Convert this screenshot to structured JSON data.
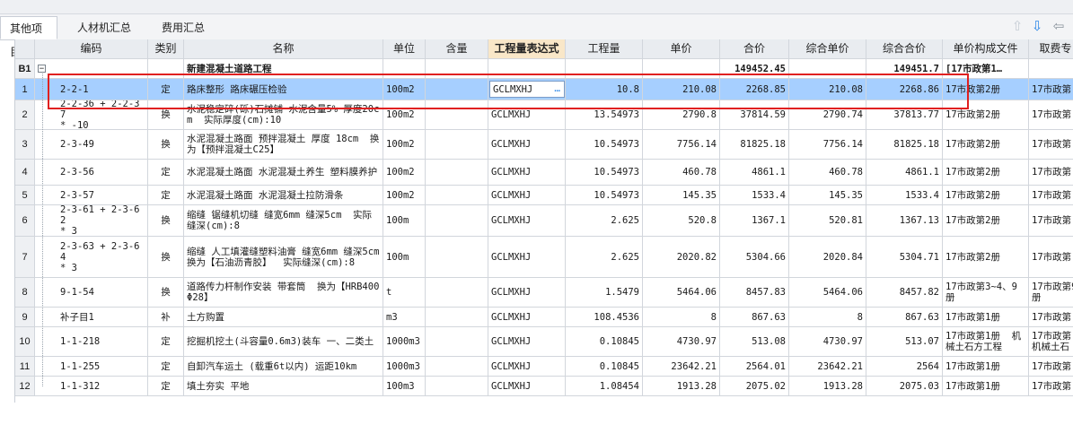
{
  "tabs": [
    "其他项目",
    "人材机汇总",
    "费用汇总"
  ],
  "columns": [
    "编码",
    "类别",
    "名称",
    "单位",
    "含量",
    "工程量表达式",
    "工程量",
    "单价",
    "合价",
    "综合单价",
    "综合合价",
    "单价构成文件",
    "取费专"
  ],
  "group_row": {
    "id": "B1",
    "toggle": "−",
    "name": "新建混凝土道路工程",
    "total": "149452.45",
    "comp_total": "149451.7",
    "file": "[17市政第1…"
  },
  "rows": [
    {
      "no": "1",
      "code": "2-2-1",
      "type": "定",
      "name": "路床整形 路床碾压检验",
      "unit": "100m2",
      "expr": "GCLMXHJ",
      "qty": "10.8",
      "price": "210.08",
      "total": "2268.85",
      "cprice": "210.08",
      "ctotal": "2268.86",
      "file": "17市政第2册",
      "fee": "17市政第"
    },
    {
      "no": "2",
      "code": "2-2-36 + 2-2-37\n* -10",
      "type": "换",
      "name": "水泥稳定碎(砾)石摊铺 水泥含量5% 厚度20cm  实际厚度(cm):10",
      "unit": "100m2",
      "expr": "GCLMXHJ",
      "qty": "13.54973",
      "price": "2790.8",
      "total": "37814.59",
      "cprice": "2790.74",
      "ctotal": "37813.77",
      "file": "17市政第2册",
      "fee": "17市政第"
    },
    {
      "no": "3",
      "code": "2-3-49",
      "type": "换",
      "name": "水泥混凝土路面 预拌混凝土 厚度 18cm  换为【预拌混凝土C25】",
      "unit": "100m2",
      "expr": "GCLMXHJ",
      "qty": "10.54973",
      "price": "7756.14",
      "total": "81825.18",
      "cprice": "7756.14",
      "ctotal": "81825.18",
      "file": "17市政第2册",
      "fee": "17市政第"
    },
    {
      "no": "4",
      "code": "2-3-56",
      "type": "定",
      "name": "水泥混凝土路面 水泥混凝土养生 塑料膜养护",
      "unit": "100m2",
      "expr": "GCLMXHJ",
      "qty": "10.54973",
      "price": "460.78",
      "total": "4861.1",
      "cprice": "460.78",
      "ctotal": "4861.1",
      "file": "17市政第2册",
      "fee": "17市政第"
    },
    {
      "no": "5",
      "code": "2-3-57",
      "type": "定",
      "name": "水泥混凝土路面 水泥混凝土拉防滑条",
      "unit": "100m2",
      "expr": "GCLMXHJ",
      "qty": "10.54973",
      "price": "145.35",
      "total": "1533.4",
      "cprice": "145.35",
      "ctotal": "1533.4",
      "file": "17市政第2册",
      "fee": "17市政第"
    },
    {
      "no": "6",
      "code": "2-3-61 + 2-3-62\n* 3",
      "type": "换",
      "name": "缩缝 锯缝机切缝 缝宽6mm 缝深5cm  实际缝深(cm):8",
      "unit": "100m",
      "expr": "GCLMXHJ",
      "qty": "2.625",
      "price": "520.8",
      "total": "1367.1",
      "cprice": "520.81",
      "ctotal": "1367.13",
      "file": "17市政第2册",
      "fee": "17市政第"
    },
    {
      "no": "7",
      "code": "2-3-63 + 2-3-64\n* 3",
      "type": "换",
      "name": "缩缝 人工填灌缝塑料油膏 缝宽6mm 缝深5cm  换为【石油沥青胶】  实际缝深(cm):8",
      "unit": "100m",
      "expr": "GCLMXHJ",
      "qty": "2.625",
      "price": "2020.82",
      "total": "5304.66",
      "cprice": "2020.84",
      "ctotal": "5304.71",
      "file": "17市政第2册",
      "fee": "17市政第"
    },
    {
      "no": "8",
      "code": "9-1-54",
      "type": "换",
      "name": "道路传力杆制作安装 带套筒  换为【HRB400Φ28】",
      "unit": "t",
      "expr": "GCLMXHJ",
      "qty": "1.5479",
      "price": "5464.06",
      "total": "8457.83",
      "cprice": "5464.06",
      "ctotal": "8457.82",
      "file": "17市政第3~4、9册",
      "fee": "17市政第9册"
    },
    {
      "no": "9",
      "code": "补子目1",
      "type": "补",
      "name": "土方购置",
      "unit": "m3",
      "expr": "GCLMXHJ",
      "qty": "108.4536",
      "price": "8",
      "total": "867.63",
      "cprice": "8",
      "ctotal": "867.63",
      "file": "17市政第1册",
      "fee": "17市政第"
    },
    {
      "no": "10",
      "code": "1-1-218",
      "type": "定",
      "name": "挖掘机挖土(斗容量0.6m3)装车 一、二类土",
      "unit": "1000m3",
      "expr": "GCLMXHJ",
      "qty": "0.10845",
      "price": "4730.97",
      "total": "513.08",
      "cprice": "4730.97",
      "ctotal": "513.07",
      "file": "17市政第1册  机械土石方工程",
      "fee": "17市政第机械土石"
    },
    {
      "no": "11",
      "code": "1-1-255",
      "type": "定",
      "name": "自卸汽车运土 (载重6t以内) 运距10km",
      "unit": "1000m3",
      "expr": "GCLMXHJ",
      "qty": "0.10845",
      "price": "23642.21",
      "total": "2564.01",
      "cprice": "23642.21",
      "ctotal": "2564",
      "file": "17市政第1册",
      "fee": "17市政第"
    },
    {
      "no": "12",
      "code": "1-1-312",
      "type": "定",
      "name": "填土夯实 平地",
      "unit": "100m3",
      "expr": "GCLMXHJ",
      "qty": "1.08454",
      "price": "1913.28",
      "total": "2075.02",
      "cprice": "1913.28",
      "ctotal": "2075.03",
      "file": "17市政第1册",
      "fee": "17市政第"
    }
  ],
  "ellipsis": "…",
  "icons": {
    "up": "arrow-up-icon",
    "down": "arrow-down-icon",
    "left": "arrow-left-icon"
  },
  "colors": {
    "selected_row": "#a6cfff",
    "highlight_header": "#f9e7c8",
    "annotation": "#e02020",
    "nav_active": "#2a86e8"
  }
}
